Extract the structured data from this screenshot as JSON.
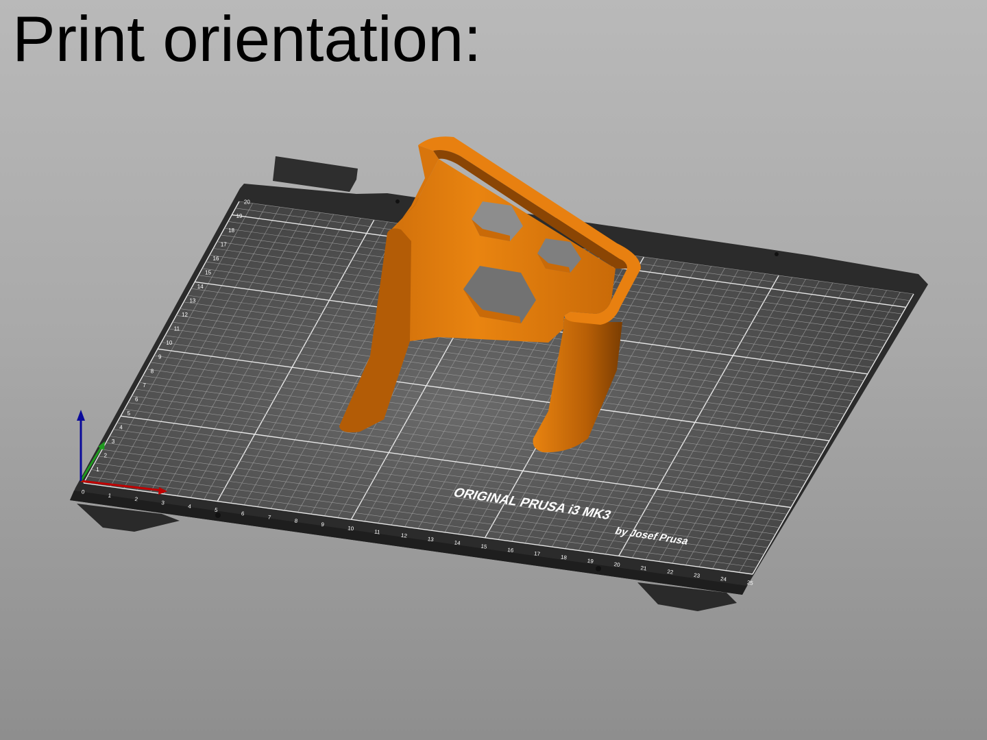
{
  "title": "Print orientation:",
  "bed": {
    "brand_line1": "ORIGINAL PRUSA i3 MK3",
    "brand_line2": "by Josef Prusa",
    "x_ticks": [
      "0",
      "1",
      "2",
      "3",
      "4",
      "5",
      "6",
      "7",
      "8",
      "9",
      "10",
      "11",
      "12",
      "13",
      "14",
      "15",
      "16",
      "17",
      "18",
      "19",
      "20",
      "21",
      "22",
      "23",
      "24",
      "25"
    ],
    "y_ticks": [
      "1",
      "2",
      "3",
      "4",
      "5",
      "6",
      "7",
      "8",
      "9",
      "10",
      "11",
      "12",
      "13",
      "14",
      "15",
      "16",
      "17",
      "18",
      "19",
      "20"
    ]
  },
  "colors": {
    "model": "#e07c10",
    "model_dark": "#a35406",
    "bed_frame": "#2b2b2b",
    "bed_surface": "#555555",
    "axis_x": "#c00000",
    "axis_y": "#1f9a1f",
    "axis_z": "#0a0a9a"
  },
  "icons": [
    "axis-gizmo-icon"
  ]
}
